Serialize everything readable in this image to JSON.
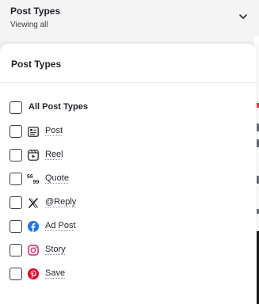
{
  "filter": {
    "title": "Post Types",
    "subtitle": "Viewing all"
  },
  "panel": {
    "title": "Post Types",
    "options": [
      {
        "label": "All Post Types",
        "icon": "none",
        "checked": false
      },
      {
        "label": "Post",
        "icon": "post-icon",
        "checked": false
      },
      {
        "label": "Reel",
        "icon": "reel-icon",
        "checked": false
      },
      {
        "label": "Quote",
        "icon": "quote-icon",
        "checked": false
      },
      {
        "label": "@Reply",
        "icon": "x-logo-icon",
        "checked": false
      },
      {
        "label": "Ad Post",
        "icon": "facebook-icon",
        "checked": false
      },
      {
        "label": "Story",
        "icon": "instagram-icon",
        "checked": false
      },
      {
        "label": "Save",
        "icon": "pinterest-icon",
        "checked": false
      }
    ]
  },
  "colors": {
    "facebook": "#1877f2",
    "instagram": "#e1306c",
    "pinterest": "#e60023",
    "text": "#1f2329"
  }
}
